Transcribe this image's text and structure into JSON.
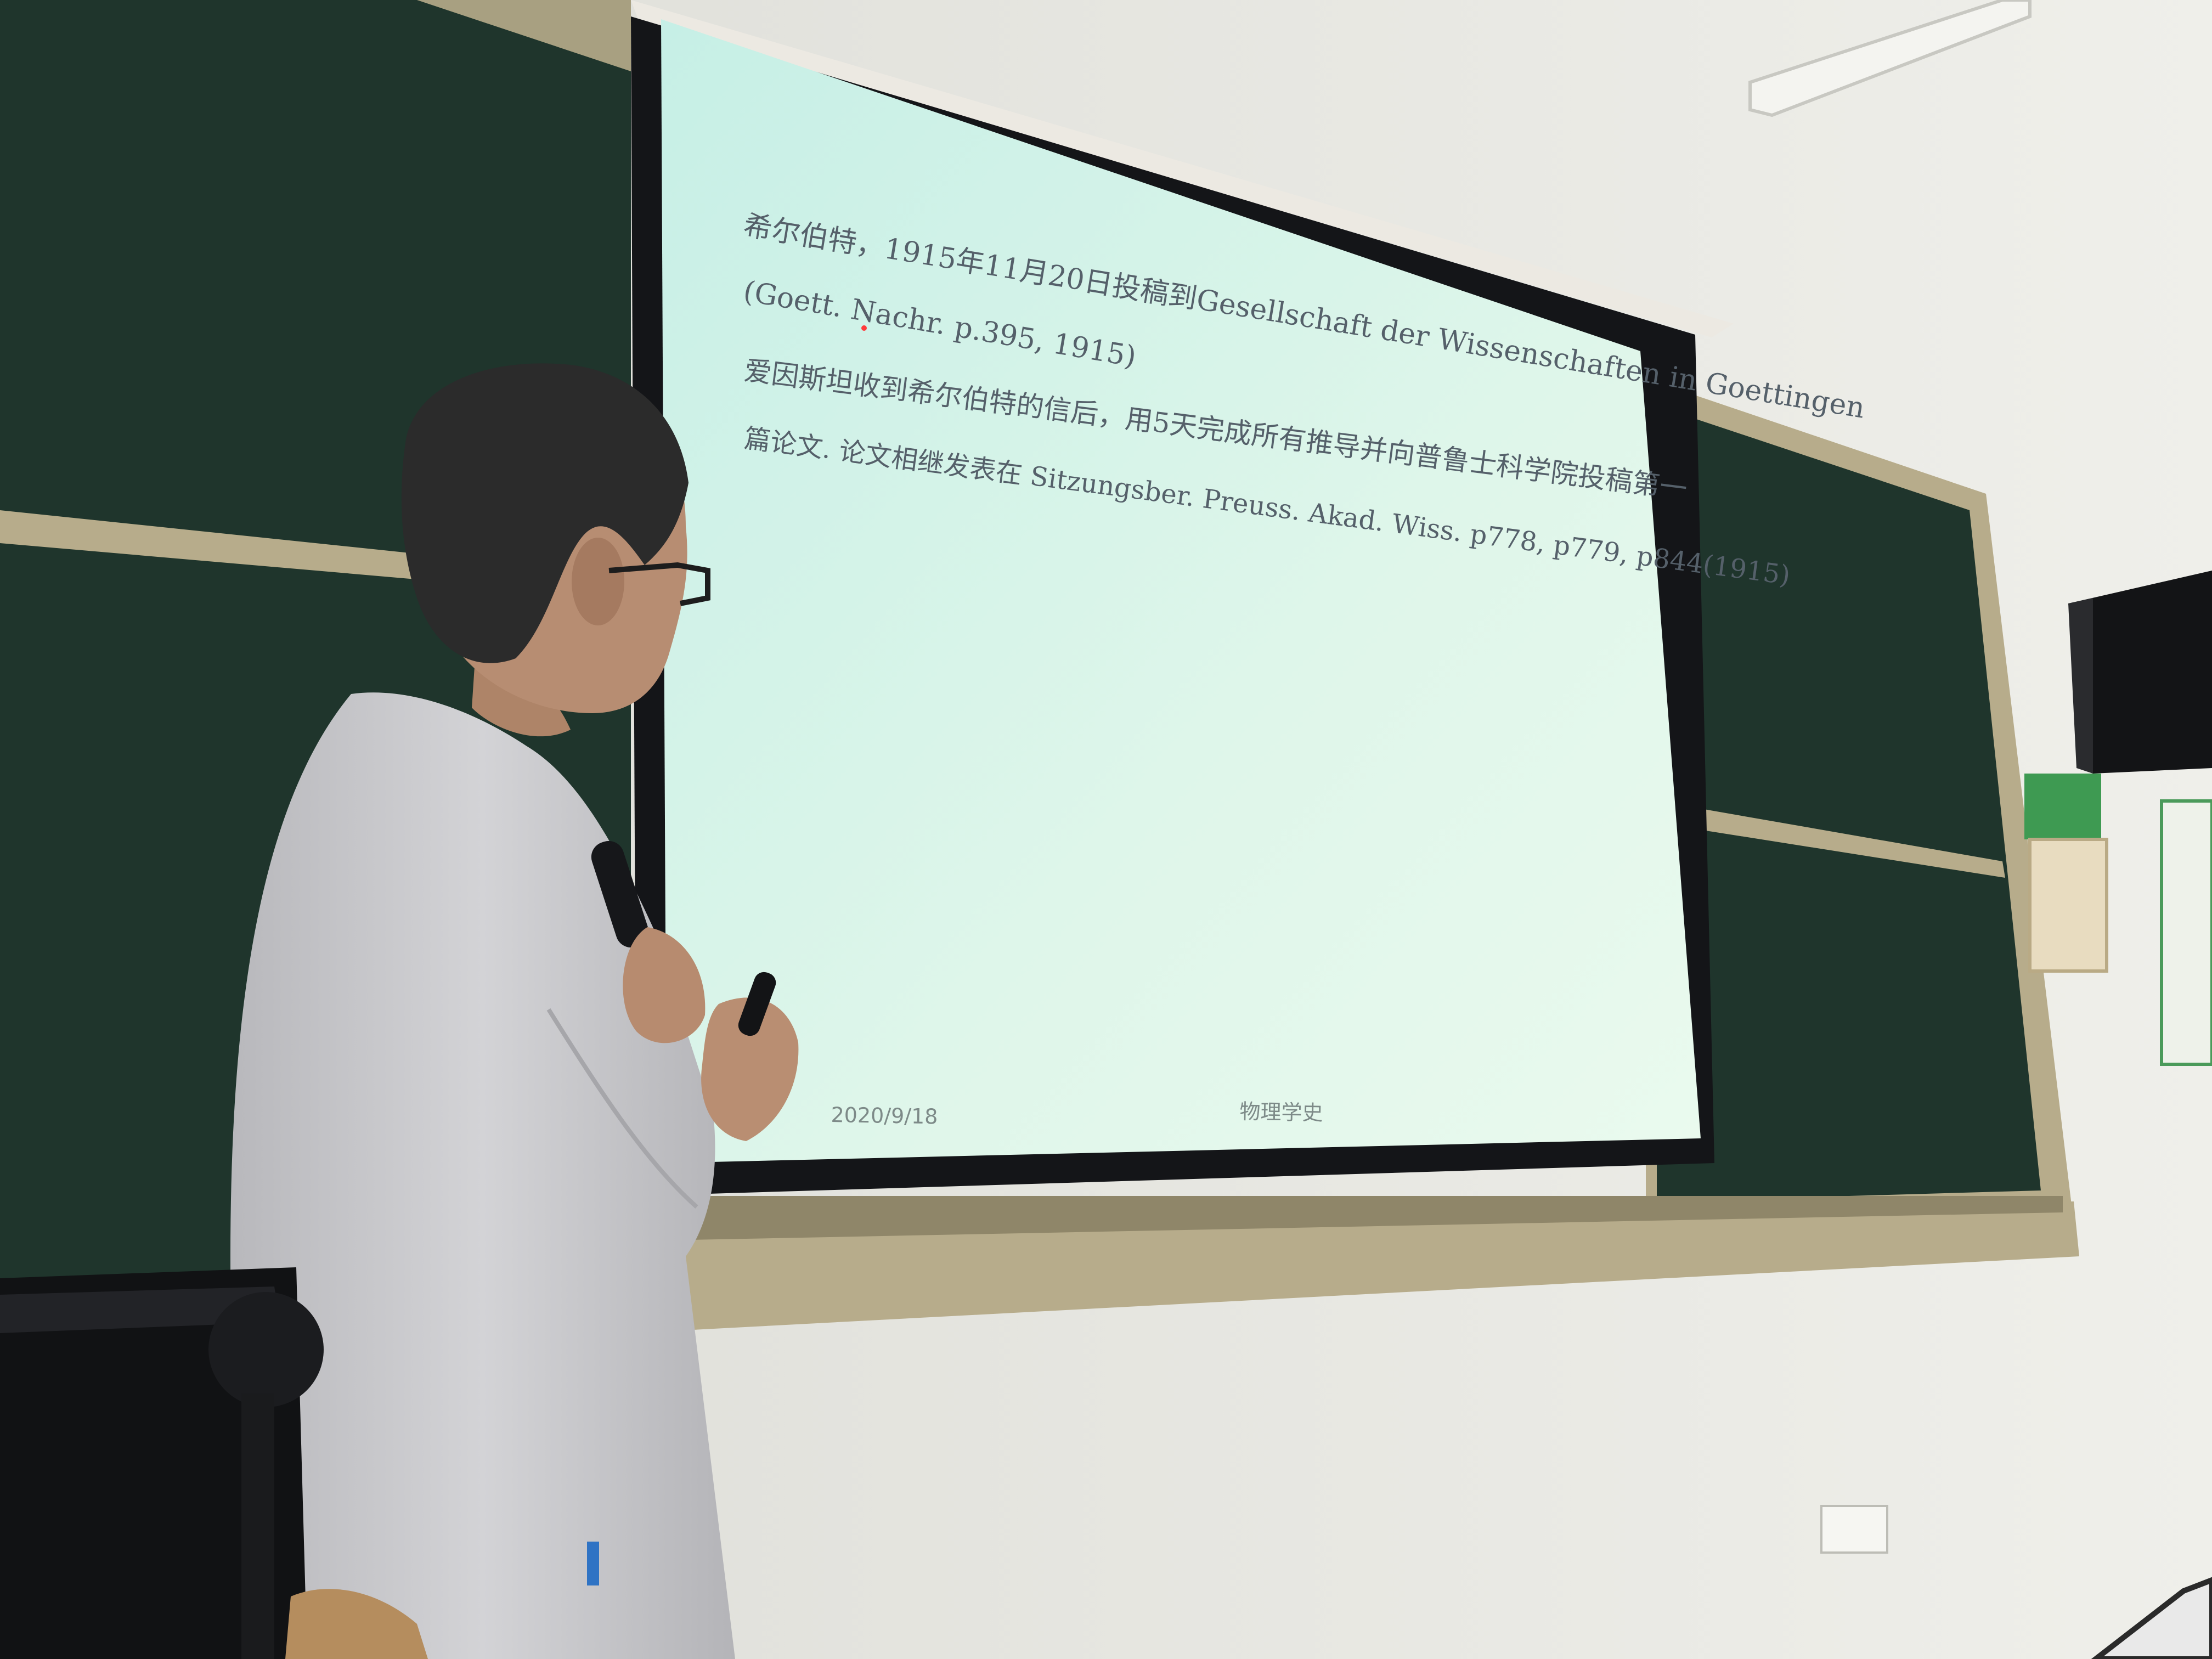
{
  "slide": {
    "lines": [
      "希尔伯特，1915年11月20日投稿到Gesellschaft der Wissenschaften in Goettingen",
      "(Goett. Nachr. p.395, 1915)",
      "爱因斯坦收到希尔伯特的信后，用5天完成所有推导并向普鲁士科学院投稿第一",
      "篇论文. 论文相继发表在 Sitzungsber. Preuss. Akad. Wiss. p778, p779, p844(1915)"
    ],
    "footer_date": "2020/9/18",
    "footer_title": "物理学史"
  },
  "colors": {
    "wall": "#e6e6e0",
    "chalkboard": "#20362e",
    "board_frame": "#b9ae8d",
    "screen_border": "#141518",
    "screen_top": "#c9f0e6",
    "screen_bottom": "#e8f8ec",
    "shirt": "#c9c9cc",
    "hair": "#2b2b2b",
    "skin": "#b98e72"
  }
}
